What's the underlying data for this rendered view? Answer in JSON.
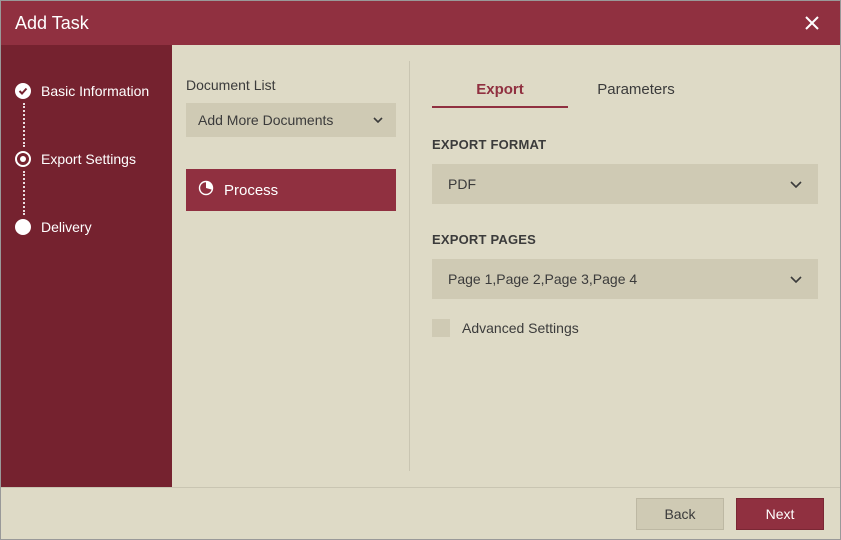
{
  "colors": {
    "accent": "#903040",
    "sidebar": "#75222f",
    "panel": "#dedac6",
    "control": "#cfcab4"
  },
  "title": "Add Task",
  "steps": [
    {
      "label": "Basic Information",
      "state": "done"
    },
    {
      "label": "Export Settings",
      "state": "current"
    },
    {
      "label": "Delivery",
      "state": "todo"
    }
  ],
  "document_list": {
    "label": "Document List",
    "add_more": "Add More Documents",
    "items": [
      {
        "icon": "pie-icon",
        "name": "Process"
      }
    ]
  },
  "tabs": [
    {
      "label": "Export",
      "active": true
    },
    {
      "label": "Parameters",
      "active": false
    }
  ],
  "export_format": {
    "label": "EXPORT FORMAT",
    "value": "PDF"
  },
  "export_pages": {
    "label": "EXPORT PAGES",
    "value": "Page 1,Page 2,Page 3,Page 4"
  },
  "advanced": {
    "label": "Advanced Settings",
    "checked": false
  },
  "footer": {
    "back": "Back",
    "next": "Next"
  }
}
